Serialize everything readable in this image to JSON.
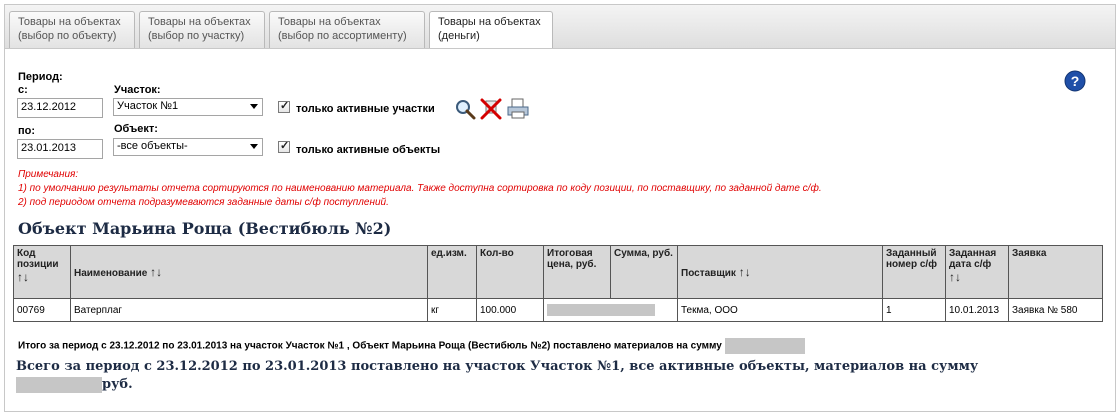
{
  "tabs": [
    {
      "line1": "Товары на объектах",
      "line2": "(выбор по объекту)"
    },
    {
      "line1": "Товары на объектах",
      "line2": "(выбор по участку)"
    },
    {
      "line1": "Товары на объектах",
      "line2": "(выбор по ассортименту)"
    },
    {
      "line1": "Товары на объектах",
      "line2": "(деньги)"
    }
  ],
  "filters": {
    "period_label": "Период:",
    "from_label": "с:",
    "from_value": "23.12.2012",
    "to_label": "по:",
    "to_value": "23.01.2013",
    "site_label": "Участок:",
    "site_value": "Участок №1",
    "object_label": "Объект:",
    "object_value": "-все объекты-",
    "active_sites_label": "только активные участки",
    "active_objects_label": "только активные объекты"
  },
  "notes": {
    "title": "Примечания:",
    "line1": "1) по умолчанию результаты отчета сортируются по наименованию материала. Также доступна сортировка по коду позиции, по поставщику, по заданной дате с/ф.",
    "line2": "2) под периодом отчета подразумеваются заданные даты с/ф поступлений."
  },
  "object_title": "Объект Марьина Роща (Вестибюль №2)",
  "table": {
    "headers": {
      "code": "Код позиции",
      "name": "Наименование",
      "unit": "ед.изм.",
      "qty": "Кол-во",
      "price": "Итоговая цена, руб.",
      "sum": "Сумма, руб.",
      "supplier": "Поставщик",
      "invoice_no": "Заданный номер с/ф",
      "invoice_date": "Заданная дата с/ф",
      "request": "Заявка"
    },
    "rows": [
      {
        "code": "00769",
        "name": "Ватерплаг",
        "unit": "кг",
        "qty": "100.000",
        "supplier": "Текма, ООО",
        "invoice_no": "1",
        "invoice_date": "10.01.2013",
        "request": "Заявка № 580"
      }
    ]
  },
  "totals": {
    "period_total": "Итого за период с 23.12.2012 по 23.01.2013 на участок Участок №1 , Объект Марьина Роща (Вестибюль №2) поставлено материалов на сумму",
    "grand_line1": "Всего за период с 23.12.2012 по 23.01.2013 поставлено на участок Участок №1, все активные объекты, материалов на сумму",
    "grand_suffix": "руб."
  },
  "icons": [
    "help-icon",
    "search-icon",
    "clear-icon",
    "print-icon",
    "sort-up-icon",
    "sort-down-icon"
  ],
  "colors": {
    "notes": "#e00000",
    "title": "#1d2b44",
    "help": "#1f4fa8"
  }
}
